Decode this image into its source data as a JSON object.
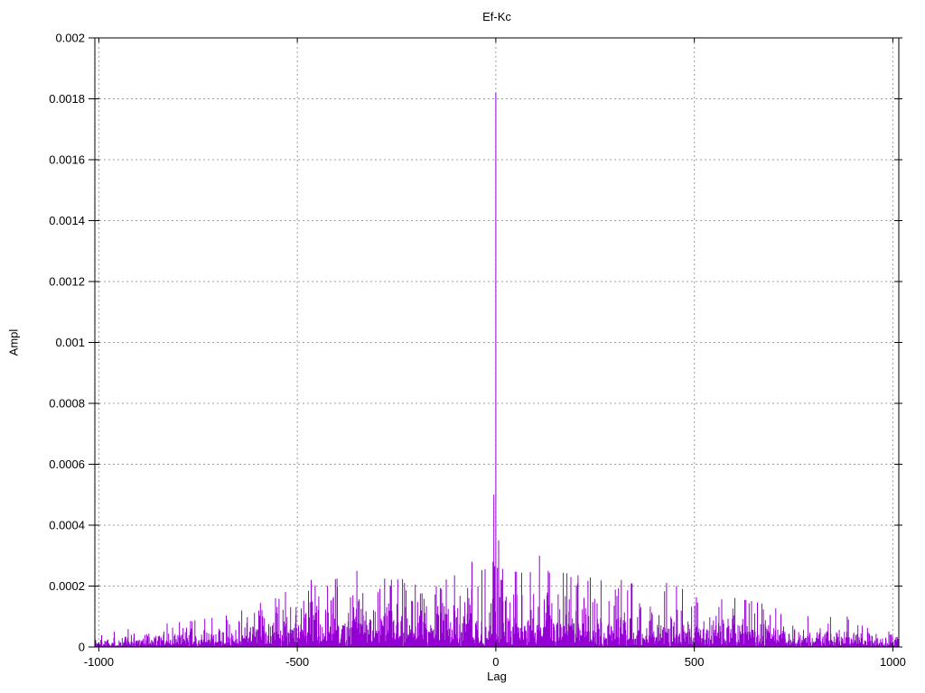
{
  "chart_data": {
    "type": "impulses",
    "title": "Ef-Kc",
    "xlabel": "Lag",
    "ylabel": "Ampl",
    "xlim": [
      -1010,
      1015
    ],
    "ylim": [
      0,
      0.002
    ],
    "xticks": [
      {
        "value": -1000,
        "label": "-1000"
      },
      {
        "value": -500,
        "label": "-500"
      },
      {
        "value": 0,
        "label": "0"
      },
      {
        "value": 500,
        "label": "500"
      },
      {
        "value": 1000,
        "label": "1000"
      }
    ],
    "yticks": [
      {
        "value": 0,
        "label": "0"
      },
      {
        "value": 0.0002,
        "label": "0.0002"
      },
      {
        "value": 0.0004,
        "label": "0.0004"
      },
      {
        "value": 0.0006,
        "label": "0.0006"
      },
      {
        "value": 0.0008,
        "label": "0.0008"
      },
      {
        "value": 0.001,
        "label": "0.001"
      },
      {
        "value": 0.0012,
        "label": "0.0012"
      },
      {
        "value": 0.0014,
        "label": "0.0014"
      },
      {
        "value": 0.0016,
        "label": "0.0016"
      },
      {
        "value": 0.0018,
        "label": "0.0018"
      },
      {
        "value": 0.002,
        "label": "0.002"
      }
    ],
    "grid": true,
    "legend": "none",
    "line_color": "#9400d3",
    "grid_color": "#9e9e9e",
    "border_color": "#000000",
    "background": "#ffffff",
    "main_peak": {
      "lag": 0,
      "ampl": 0.00182
    },
    "secondary_peaks": [
      [
        -5,
        0.0005
      ],
      [
        -7,
        0.00028
      ],
      [
        -3,
        0.00024
      ],
      [
        4,
        0.00026
      ],
      [
        7,
        0.00035
      ],
      [
        12,
        0.00022
      ],
      [
        -60,
        0.00028
      ],
      [
        110,
        0.0003
      ],
      [
        -350,
        0.00025
      ],
      [
        -465,
        0.00022
      ],
      [
        170,
        0.00024
      ],
      [
        316,
        0.00022
      ],
      [
        -230,
        0.00021
      ],
      [
        430,
        0.00021
      ],
      [
        455,
        0.0002
      ],
      [
        -150,
        0.0002
      ],
      [
        885,
        0.0001
      ],
      [
        -640,
        0.00012
      ]
    ],
    "noise_envelope": [
      [
        -1010,
        1.4e-05
      ],
      [
        -900,
        1.8e-05
      ],
      [
        -780,
        2.2e-05
      ],
      [
        -660,
        2.8e-05
      ],
      [
        -580,
        4e-05
      ],
      [
        -500,
        5.2e-05
      ],
      [
        -420,
        6.2e-05
      ],
      [
        -340,
        6.2e-05
      ],
      [
        -260,
        5.8e-05
      ],
      [
        -180,
        6e-05
      ],
      [
        -100,
        6.2e-05
      ],
      [
        -40,
        6.6e-05
      ],
      [
        0,
        7e-05
      ],
      [
        60,
        6.4e-05
      ],
      [
        140,
        6.6e-05
      ],
      [
        240,
        6e-05
      ],
      [
        340,
        5.5e-05
      ],
      [
        440,
        5.2e-05
      ],
      [
        540,
        4.6e-05
      ],
      [
        640,
        4e-05
      ],
      [
        740,
        3.2e-05
      ],
      [
        840,
        2.6e-05
      ],
      [
        920,
        2.2e-05
      ],
      [
        1015,
        1.4e-05
      ]
    ],
    "noise_seed": 1337,
    "lag_step": 1
  }
}
